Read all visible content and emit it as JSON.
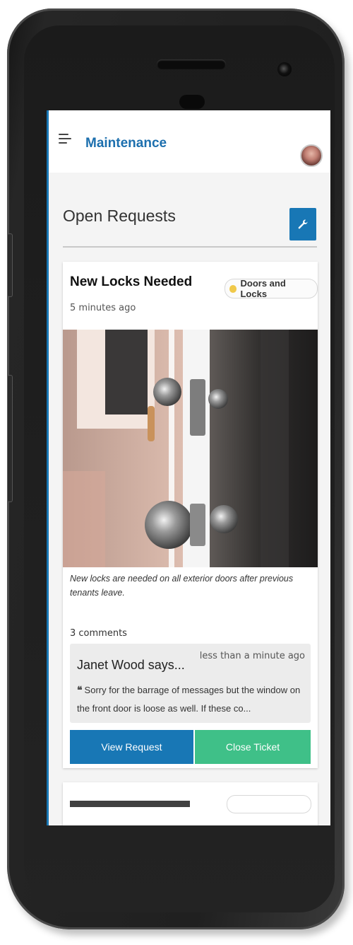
{
  "header": {
    "app_title": "Maintenance"
  },
  "section": {
    "title": "Open Requests"
  },
  "request": {
    "title": "New Locks Needed",
    "time_ago": "5 minutes ago",
    "category": "Doors and Locks",
    "category_color": "#f0c94a",
    "description": "New locks are needed on all exterior doors after previous tenants leave.",
    "comments_count": "3 comments",
    "latest_comment": {
      "author": "Janet Wood says...",
      "time": "less than a minute ago",
      "text": "Sorry for the barrage of messages but the window on the front door is loose as well. If these co..."
    },
    "actions": {
      "view_label": "View Request",
      "close_label": "Close Ticket"
    }
  },
  "colors": {
    "primary": "#1877b5",
    "success": "#3fc088",
    "title_blue": "#1c6fae"
  },
  "icons": {
    "menu": "hamburger-menu-icon",
    "settings": "wrench-icon",
    "quote": "quote-icon",
    "category": "dot-icon"
  }
}
